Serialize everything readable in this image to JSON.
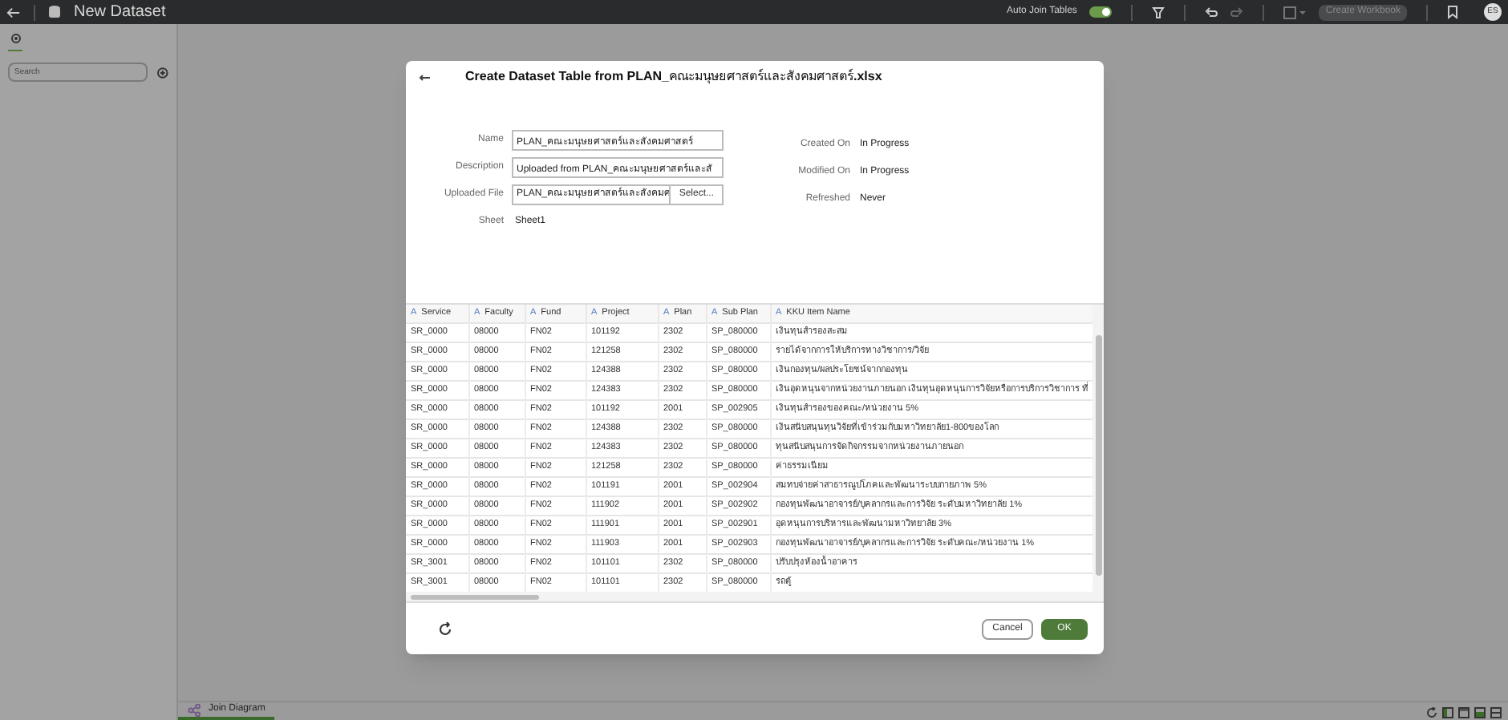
{
  "app_bar": {
    "title": "New Dataset",
    "auto_join": {
      "label": "Auto Join Tables",
      "on": true
    },
    "create_workbook": {
      "label": "Create Workbook",
      "disabled": true
    },
    "avatar": "ES"
  },
  "sidebar": {
    "search": {
      "placeholder": "Search"
    }
  },
  "dialog": {
    "title": "**Create Dataset Table from PLAN_**คณะมนุษยศาสตร์และสังคมศาสตร์**.xlsx**",
    "fields": [
      {
        "label": "Name",
        "value": "PLAN_คณะมนุษยศาสตร์และสังคมศาสตร์"
      },
      {
        "label": "Description",
        "value": "Uploaded from PLAN_คณะมนุษยศาสตร์และสั"
      },
      {
        "label": "Uploaded File",
        "value": "PLAN_คณะมนุษยศาสตร์และสังคมศ",
        "button": "Select..."
      }
    ],
    "sheet": {
      "label": "Sheet",
      "value": "Sheet1"
    },
    "info": [
      {
        "label": "Created On",
        "value": "In Progress"
      },
      {
        "label": "Modified On",
        "value": "In Progress"
      },
      {
        "label": "Refreshed",
        "value": "Never"
      }
    ],
    "table": {
      "columns": [
        {
          "type": "A",
          "name": "Service"
        },
        {
          "type": "A",
          "name": "Faculty"
        },
        {
          "type": "A",
          "name": "Fund"
        },
        {
          "type": "A",
          "name": "Project"
        },
        {
          "type": "A",
          "name": "Plan"
        },
        {
          "type": "A",
          "name": "Sub Plan"
        },
        {
          "type": "A",
          "name": "KKU Item Name"
        }
      ],
      "rows": [
        [
          "SR_0000",
          "08000",
          "FN02",
          "101192",
          "2302",
          "SP_080000",
          "เงินทุนสำรองสะสม"
        ],
        [
          "SR_0000",
          "08000",
          "FN02",
          "121258",
          "2302",
          "SP_080000",
          "รายได้จากการให้บริการทางวิชาการ/วิจัย"
        ],
        [
          "SR_0000",
          "08000",
          "FN02",
          "124388",
          "2302",
          "SP_080000",
          "เงินกองทุน/ผลประโยชน์จากกองทุน"
        ],
        [
          "SR_0000",
          "08000",
          "FN02",
          "124383",
          "2302",
          "SP_080000",
          "เงินอุดหนุนจากหน่วยงานภายนอก เงินทุนอุดหนุนการวิจัยหรือการบริการวิชาการ ที่"
        ],
        [
          "SR_0000",
          "08000",
          "FN02",
          "101192",
          "2001",
          "SP_002905",
          "เงินทุนสำรองของคณะ/หน่วยงาน 5%"
        ],
        [
          "SR_0000",
          "08000",
          "FN02",
          "124388",
          "2302",
          "SP_080000",
          "เงินสนับสนุนทุนวิจัยที่เข้าร่วมกับมหาวิทยาลัย1-800ของโลก"
        ],
        [
          "SR_0000",
          "08000",
          "FN02",
          "124383",
          "2302",
          "SP_080000",
          "ทุนสนับสนุนการจัดกิจกรรมจากหน่วยงานภายนอก"
        ],
        [
          "SR_0000",
          "08000",
          "FN02",
          "121258",
          "2302",
          "SP_080000",
          "ค่าธรรมเนียม"
        ],
        [
          "SR_0000",
          "08000",
          "FN02",
          "101191",
          "2001",
          "SP_002904",
          "สมทบจ่ายค่าสาธารณูปโภคและพัฒนาระบบกายภาพ 5%"
        ],
        [
          "SR_0000",
          "08000",
          "FN02",
          "111902",
          "2001",
          "SP_002902",
          "กองทุนพัฒนาอาจารย์/บุคลากรและการวิจัย ระดับมหาวิทยาลัย 1%"
        ],
        [
          "SR_0000",
          "08000",
          "FN02",
          "111901",
          "2001",
          "SP_002901",
          "อุดหนุนการบริหารและพัฒนามหาวิทยาลัย 3%"
        ],
        [
          "SR_0000",
          "08000",
          "FN02",
          "111903",
          "2001",
          "SP_002903",
          "กองทุนพัฒนาอาจารย์/บุคลากรและการวิจัย ระดับคณะ/หน่วยงาน 1%"
        ],
        [
          "SR_3001",
          "08000",
          "FN02",
          "101101",
          "2302",
          "SP_080000",
          "ปรับปรุงห้องน้ำอาคาร"
        ],
        [
          "SR_3001",
          "08000",
          "FN02",
          "101101",
          "2302",
          "SP_080000",
          "รถตู้"
        ]
      ]
    },
    "buttons": [
      {
        "label": "Cancel",
        "kind": "secondary"
      },
      {
        "label": "OK",
        "kind": "primary"
      }
    ]
  },
  "bottom_tabs": [
    {
      "label": "Join Diagram",
      "selected": true
    }
  ]
}
